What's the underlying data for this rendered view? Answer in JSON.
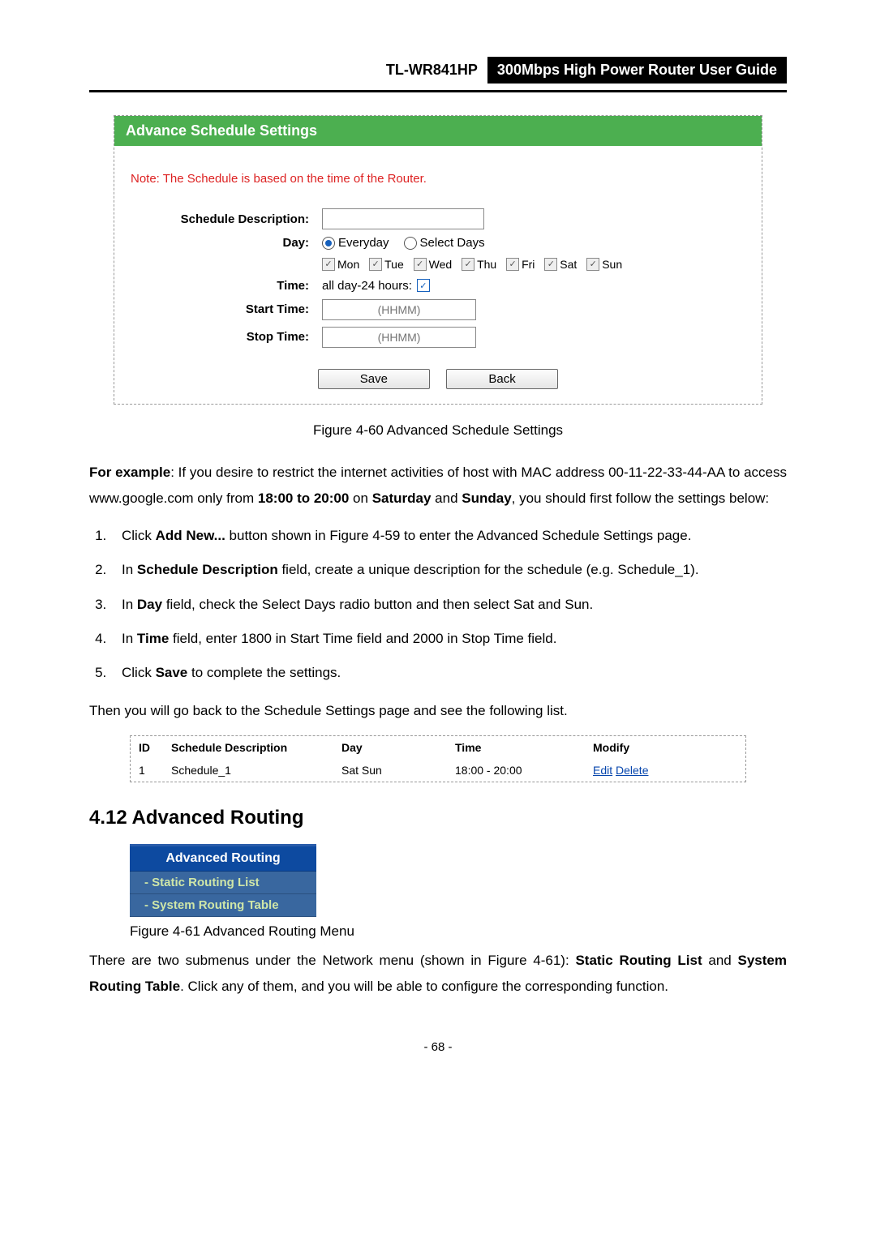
{
  "header": {
    "model": "TL-WR841HP",
    "title": "300Mbps High Power Router User Guide"
  },
  "panel": {
    "title": "Advance Schedule Settings",
    "note": "Note: The Schedule is based on the time of the Router.",
    "labels": {
      "desc": "Schedule Description:",
      "day": "Day:",
      "time": "Time:",
      "start": "Start Time:",
      "stop": "Stop Time:"
    },
    "radio": {
      "everyday": "Everyday",
      "select": "Select Days"
    },
    "days": [
      "Mon",
      "Tue",
      "Wed",
      "Thu",
      "Fri",
      "Sat",
      "Sun"
    ],
    "timeText": "all day-24 hours:",
    "hhmm": "(HHMM)",
    "buttons": {
      "save": "Save",
      "back": "Back"
    }
  },
  "figure1": "Figure 4-60    Advanced Schedule Settings",
  "para1_a": "For example",
  "para1_b": ": If you desire to restrict the internet activities of host with MAC address 00-11-22-33-44-AA to access www.google.com only from ",
  "para1_c": "18:00 to 20:00",
  "para1_d": " on ",
  "para1_e": "Saturday",
  "para1_f": " and ",
  "para1_g": "Sunday",
  "para1_h": ", you should first follow the settings below:",
  "steps": {
    "s1a": "Click ",
    "s1b": "Add New...",
    "s1c": " button shown in Figure 4-59 to enter the Advanced Schedule Settings page.",
    "s2a": "In ",
    "s2b": "Schedule Description",
    "s2c": " field, create a unique description for the schedule (e.g. Schedule_1).",
    "s3a": "In ",
    "s3b": "Day",
    "s3c": " field, check the Select Days radio button and then select Sat and Sun.",
    "s4a": "In ",
    "s4b": "Time",
    "s4c": " field, enter 1800 in Start Time field and 2000 in Stop Time field.",
    "s5a": "Click ",
    "s5b": "Save",
    "s5c": " to complete the settings."
  },
  "para2": "Then you will go back to the Schedule Settings page and see the following list.",
  "table": {
    "head": {
      "id": "ID",
      "desc": "Schedule Description",
      "day": "Day",
      "time": "Time",
      "mod": "Modify"
    },
    "row": {
      "id": "1",
      "desc": "Schedule_1",
      "day": "Sat Sun",
      "time": "18:00 - 20:00",
      "edit": "Edit",
      "del": "Delete"
    }
  },
  "section": "4.12 Advanced Routing",
  "menu": {
    "title": "Advanced Routing",
    "items": [
      "- Static Routing List",
      "- System Routing Table"
    ]
  },
  "figure2": "Figure 4-61 Advanced Routing Menu",
  "para3_a": "There are two submenus under the Network menu (shown in Figure 4-61): ",
  "para3_b": "Static Routing List",
  "para3_c": " and ",
  "para3_d": "System Routing Table",
  "para3_e": ". Click any of them, and you will be able to configure the corresponding function.",
  "page": "- 68 -"
}
